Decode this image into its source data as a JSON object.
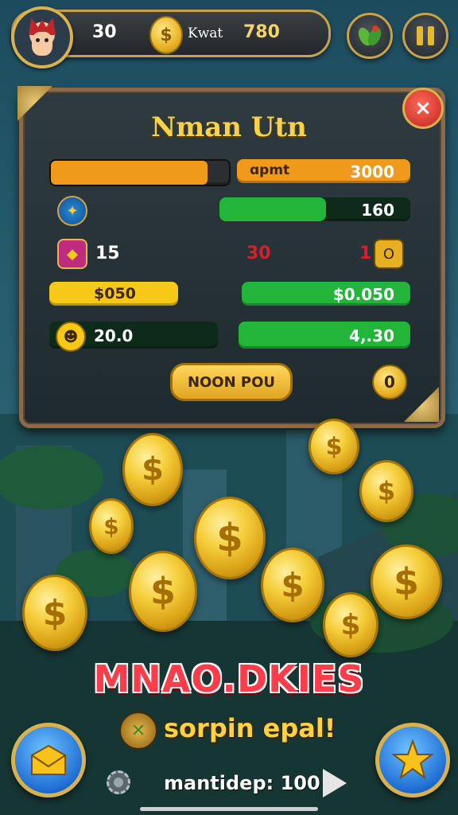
{
  "hud": {
    "level": "30",
    "currency_label": "Kwat",
    "currency_value": "780",
    "coin_symbol": "$"
  },
  "panel": {
    "title": "Nman Utn",
    "close_symbol": "×",
    "rows": [
      {
        "label": "ɑpmt",
        "value": "3000"
      },
      {
        "value": "160"
      },
      {
        "left_value": "15",
        "mid_value": "30",
        "right_value": "1",
        "right_badge": "O"
      },
      {
        "left_value": "$050",
        "right_value": "$0.050"
      },
      {
        "left_value": "20.0",
        "right_value": "4,.30"
      }
    ],
    "action_label": "NOON POU",
    "action_count": "0"
  },
  "coins": {
    "symbol": "$"
  },
  "promo": {
    "title": "MNAO.DKIES",
    "subtitle": "sorpin epal!"
  },
  "footer": {
    "text": "mantidep: 100"
  },
  "colors": {
    "accent_gold": "#d9b24f",
    "bar_orange": "#f09a1c",
    "bar_green": "#22b53a",
    "bar_yellow": "#f7c815",
    "title_red": "#ff3d4a"
  }
}
